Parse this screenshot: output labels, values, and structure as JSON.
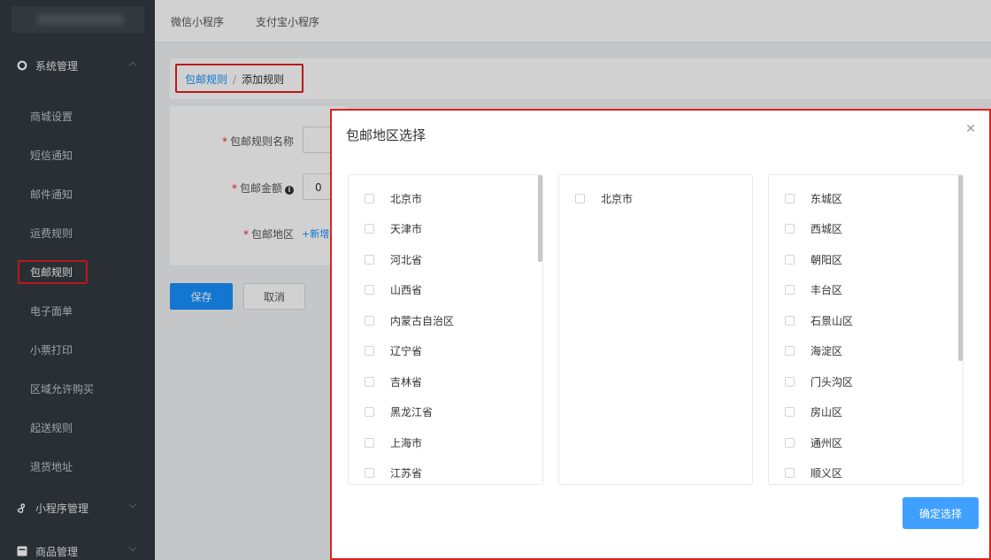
{
  "top_tabs": [
    "微信小程序",
    "支付宝小程序"
  ],
  "sidebar": {
    "groups": [
      {
        "label": "系统管理",
        "icon": "settings-icon",
        "expanded": true
      },
      {
        "label": "小程序管理",
        "icon": "miniprogram-icon",
        "expanded": false
      },
      {
        "label": "商品管理",
        "icon": "goods-icon",
        "expanded": false
      }
    ],
    "items": [
      "商城设置",
      "短信通知",
      "邮件通知",
      "运费规则",
      "包邮规则",
      "电子面单",
      "小票打印",
      "区域允许购买",
      "起送规则",
      "退货地址"
    ],
    "active_item": "包邮规则"
  },
  "breadcrumb": {
    "parent": "包邮规则",
    "separator": "/",
    "current": "添加规则"
  },
  "form": {
    "name_label": "包邮规则名称",
    "amount_label": "包邮金额",
    "amount_value": "0",
    "region_label": "包邮地区",
    "add_region_link": "+新增",
    "required_mark": "*",
    "info_icon": "info-icon"
  },
  "buttons": {
    "save": "保存",
    "cancel": "取消"
  },
  "modal": {
    "title": "包邮地区选择",
    "close_icon": "close-icon",
    "provinces": [
      "北京市",
      "天津市",
      "河北省",
      "山西省",
      "内蒙古自治区",
      "辽宁省",
      "吉林省",
      "黑龙江省",
      "上海市",
      "江苏省"
    ],
    "cities": [
      "北京市"
    ],
    "districts": [
      "东城区",
      "西城区",
      "朝阳区",
      "丰台区",
      "石景山区",
      "海淀区",
      "门头沟区",
      "房山区",
      "通州区",
      "顺义区"
    ],
    "confirm": "确定选择"
  },
  "colors": {
    "primary": "#1890ff",
    "sidebar_bg": "#333a40",
    "highlight_border": "#e02020"
  }
}
